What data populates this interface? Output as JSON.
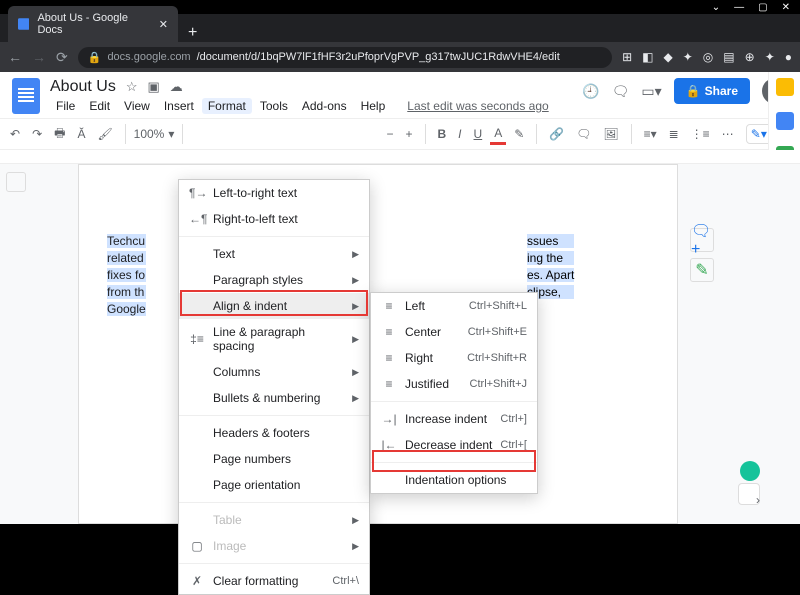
{
  "browser": {
    "tab_title": "About Us - Google Docs",
    "url_host": "docs.google.com",
    "url_path": "/document/d/1bqPW7lF1fHF3r2uPfoprVgPVP_g317twJUC1RdwVHE4/edit",
    "window_controls": {
      "min": "—",
      "max": "▢",
      "close": "✕",
      "down": "⌄"
    }
  },
  "doc": {
    "title": "About Us",
    "menus": [
      "File",
      "Edit",
      "View",
      "Insert",
      "Format",
      "Tools",
      "Add-ons",
      "Help"
    ],
    "active_menu_index": 4,
    "last_edit": "Last edit was seconds ago",
    "share": "Share"
  },
  "toolbar": {
    "zoom": "100%",
    "bold": "B",
    "italic": "I",
    "underline": "U",
    "color": "A"
  },
  "format_menu": {
    "ltr": "Left-to-right text",
    "rtl": "Right-to-left text",
    "text": "Text",
    "pstyles": "Paragraph styles",
    "align": "Align & indent",
    "spacing": "Line & paragraph spacing",
    "columns": "Columns",
    "bullets": "Bullets & numbering",
    "headers": "Headers & footers",
    "pagenums": "Page numbers",
    "orientation": "Page orientation",
    "table": "Table",
    "image": "Image",
    "clear": "Clear formatting",
    "clear_sc": "Ctrl+\\"
  },
  "align_submenu": {
    "left": {
      "label": "Left",
      "shortcut": "Ctrl+Shift+L"
    },
    "center": {
      "label": "Center",
      "shortcut": "Ctrl+Shift+E"
    },
    "right": {
      "label": "Right",
      "shortcut": "Ctrl+Shift+R"
    },
    "justified": {
      "label": "Justified",
      "shortcut": "Ctrl+Shift+J"
    },
    "inc": {
      "label": "Increase indent",
      "shortcut": "Ctrl+]"
    },
    "dec": {
      "label": "Decrease indent",
      "shortcut": "Ctrl+["
    },
    "options": "Indentation options"
  },
  "body_lines": [
    "Techcu",
    "related",
    "fixes fo",
    "from th",
    "Google"
  ],
  "body_suffix": [
    "ssues",
    "ing the",
    "es. Apart",
    "clipse,"
  ],
  "rail_colors": [
    "#fbbc04",
    "#4285f4",
    "#34a853",
    "#9aa0a6"
  ]
}
